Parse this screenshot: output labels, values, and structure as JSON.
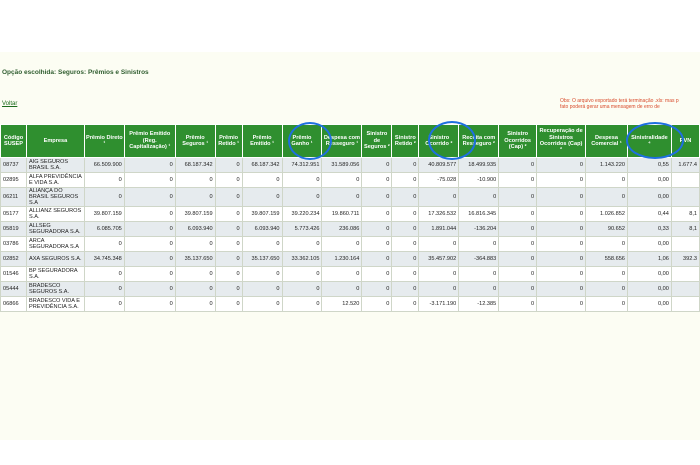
{
  "page": {
    "option_label": "Opção escolhida: Seguros: Prêmios e Sinistros",
    "back_link": "Voltar",
    "notice_line1": "Obs: O arquivo exportado terá terminação .xls: mas p",
    "notice_line2": "fato poderá gerar uma mensagem de erro de"
  },
  "table": {
    "headers": [
      "Código SUSEP",
      "Empresa",
      "Prêmio Direto ¹",
      "Prêmio Emitido (Reg. Capitalização) ¹",
      "Prêmio Seguros ¹",
      "Prêmio Retido ¹",
      "Prêmio Emitido ¹",
      "Prêmio Ganho ¹",
      "Despesa com Resseguro ¹",
      "Sinistro de Seguros ²",
      "Sinistro Retido ²",
      "Sinistro Ocorrido ²",
      "Receita com Resseguro ²",
      "Sinistro Ocorridos (Cap) ²",
      "Recuperação de Sinistros Ocorridos (Cap) ²",
      "Despesa Comercial ¹",
      "Sinistralidade ⁴",
      "RVN"
    ],
    "rows": [
      [
        "08737",
        "AIG SEGUROS BRASIL S.A.",
        "66.509.900",
        "0",
        "68.187.342",
        "0",
        "68.187.342",
        "74.312.951",
        "31.589.056",
        "0",
        "0",
        "40.809.577",
        "18.499.935",
        "0",
        "0",
        "1.143.220",
        "0,55",
        "1.677.4"
      ],
      [
        "02895",
        "ALFA PREVIDÊNCIA E VIDA S.A.",
        "0",
        "0",
        "0",
        "0",
        "0",
        "0",
        "0",
        "0",
        "0",
        "-75.028",
        "-10.900",
        "0",
        "0",
        "0",
        "0,00",
        ""
      ],
      [
        "06211",
        "ALIANÇA DO BRASIL SEGUROS S.A",
        "0",
        "0",
        "0",
        "0",
        "0",
        "0",
        "0",
        "0",
        "0",
        "0",
        "0",
        "0",
        "0",
        "0",
        "0,00",
        ""
      ],
      [
        "05177",
        "ALLIANZ SEGUROS S.A.",
        "39.807.159",
        "0",
        "39.807.159",
        "0",
        "39.807.159",
        "39.220.234",
        "19.860.711",
        "0",
        "0",
        "17.326.532",
        "16.816.345",
        "0",
        "0",
        "1.026.852",
        "0,44",
        "8,1"
      ],
      [
        "05819",
        "ALLSEG SEGURADORA S.A.",
        "6.085.705",
        "0",
        "6.093.940",
        "0",
        "6.093.940",
        "5.773.426",
        "236.086",
        "0",
        "0",
        "1.891.044",
        "-136.204",
        "0",
        "0",
        "90.652",
        "0,33",
        "8,1"
      ],
      [
        "03786",
        "ARCA SEGURADORA S.A",
        "0",
        "0",
        "0",
        "0",
        "0",
        "0",
        "0",
        "0",
        "0",
        "0",
        "0",
        "0",
        "0",
        "0",
        "0,00",
        ""
      ],
      [
        "02852",
        "AXA SEGUROS S.A.",
        "34.745.348",
        "0",
        "35.137.650",
        "0",
        "35.137.650",
        "33.362.105",
        "1.230.164",
        "0",
        "0",
        "35.457.902",
        "-364.883",
        "0",
        "0",
        "558.656",
        "1,06",
        "392.3"
      ],
      [
        "01546",
        "BP SEGURADORA S.A.",
        "0",
        "0",
        "0",
        "0",
        "0",
        "0",
        "0",
        "0",
        "0",
        "0",
        "0",
        "0",
        "0",
        "0",
        "0,00",
        ""
      ],
      [
        "05444",
        "BRADESCO SEGUROS S.A.",
        "0",
        "0",
        "0",
        "0",
        "0",
        "0",
        "0",
        "0",
        "0",
        "0",
        "0",
        "0",
        "0",
        "0",
        "0,00",
        ""
      ],
      [
        "06866",
        "BRADESCO VIDA E PREVIDÊNCIA S.A.",
        "0",
        "0",
        "0",
        "0",
        "0",
        "0",
        "12.520",
        "0",
        "0",
        "-3.171.190",
        "-12.385",
        "0",
        "0",
        "0",
        "0,00",
        ""
      ]
    ]
  },
  "colors": {
    "header_bg": "#2f8f2f",
    "row_alt_bg": "#e6ebee",
    "annotation_circle": "#1e6fe0",
    "notice_text": "#d84a2a"
  }
}
